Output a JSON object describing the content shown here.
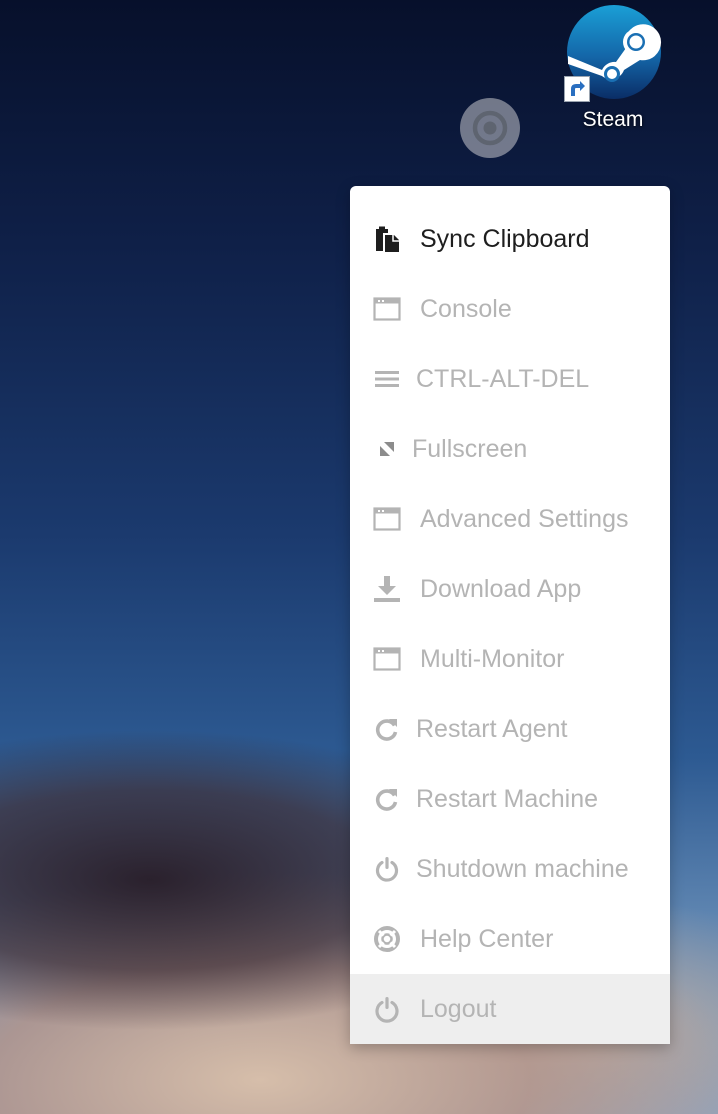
{
  "desktop": {
    "shortcut": {
      "label": "Steam",
      "icon": "steam-icon"
    }
  },
  "toggle": {
    "icon": "target-icon"
  },
  "menu": {
    "items": [
      {
        "label": "Sync Clipboard",
        "icon": "clipboard-icon",
        "state": "active"
      },
      {
        "label": "Console",
        "icon": "window-icon",
        "state": "disabled"
      },
      {
        "label": "CTRL-ALT-DEL",
        "icon": "hamburger-icon",
        "state": "disabled"
      },
      {
        "label": "Fullscreen",
        "icon": "expand-icon",
        "state": "disabled"
      },
      {
        "label": "Advanced Settings",
        "icon": "window-icon",
        "state": "disabled"
      },
      {
        "label": "Download App",
        "icon": "download-icon",
        "state": "disabled"
      },
      {
        "label": "Multi-Monitor",
        "icon": "window-icon",
        "state": "disabled"
      },
      {
        "label": "Restart Agent",
        "icon": "refresh-icon",
        "state": "disabled"
      },
      {
        "label": "Restart Machine",
        "icon": "refresh-icon",
        "state": "disabled"
      },
      {
        "label": "Shutdown machine",
        "icon": "power-icon",
        "state": "disabled"
      },
      {
        "label": "Help Center",
        "icon": "lifebuoy-icon",
        "state": "disabled"
      },
      {
        "label": "Logout",
        "icon": "power-icon",
        "state": "hovered"
      }
    ]
  },
  "colors": {
    "active_text": "#1e1e1e",
    "disabled_text": "#b4b4b4",
    "hover_background": "#eeeeee",
    "menu_background": "#ffffff"
  }
}
